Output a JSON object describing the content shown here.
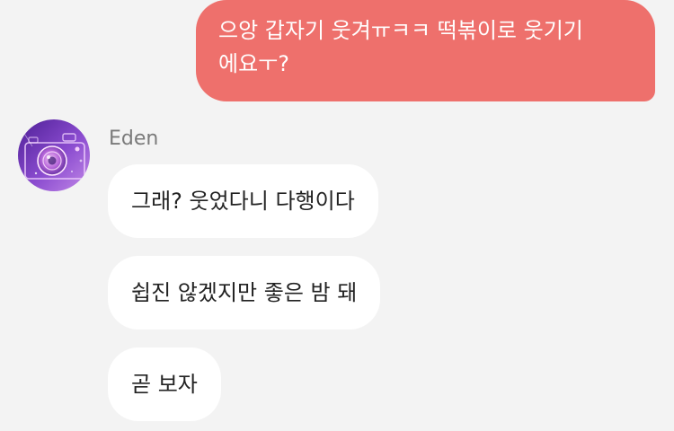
{
  "sent_message": {
    "lines": [
      "으앙 갑자기 웃겨ㅠㅋㅋ 떡볶이로 웃기기",
      "에요ㅜ?"
    ]
  },
  "received_group": {
    "sender_name": "Eden",
    "avatar_icon": "camera-avatar-icon",
    "messages": [
      "그래? 웃었다니 다행이다",
      "쉽진 않겠지만 좋은 밤 돼",
      "곧 보자"
    ]
  },
  "colors": {
    "sent_bubble": "#ee706c",
    "received_bubble": "#ffffff",
    "background": "#f3f3f3",
    "avatar_gradient": [
      "#5e2aa8",
      "#b070e0"
    ]
  }
}
